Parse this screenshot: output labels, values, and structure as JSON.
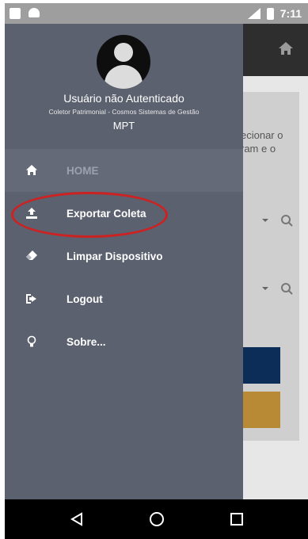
{
  "status_bar": {
    "time": "7:11"
  },
  "user": {
    "name": "Usuário não Autenticado",
    "subtitle": "Coletor Patrimonial - Cosmos Sistemas de Gestão",
    "org": "MPT"
  },
  "menu": {
    "items": [
      {
        "label": "HOME",
        "icon": "home-icon"
      },
      {
        "label": "Exportar Coleta",
        "icon": "upload-icon"
      },
      {
        "label": "Limpar Dispositivo",
        "icon": "eraser-icon"
      },
      {
        "label": "Logout",
        "icon": "logout-icon"
      },
      {
        "label": "Sobre...",
        "icon": "lightbulb-icon"
      }
    ]
  },
  "background_app": {
    "partial_text": "ecionar o\nram e o"
  },
  "colors": {
    "drawer": "#5b616f",
    "status_bar": "#9e9e9e",
    "highlight": "#cc2222",
    "button_blue": "#0b2d57",
    "button_orange": "#b98a35"
  }
}
